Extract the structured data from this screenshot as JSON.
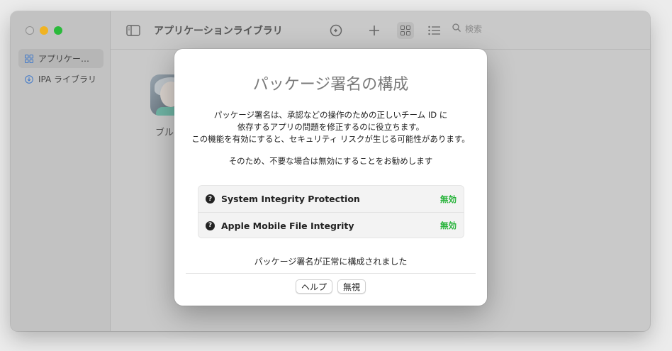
{
  "sidebar": {
    "items": [
      {
        "label": "アプリケー…",
        "icon": "grid-icon",
        "active": true
      },
      {
        "label": "IPA ライブラリ",
        "icon": "download-circle-icon",
        "active": false
      }
    ]
  },
  "toolbar": {
    "title": "アプリケーションライブラリ",
    "search_placeholder": "検索",
    "icons": [
      "sidebar-toggle-icon",
      "sync-icon",
      "plus-icon",
      "grid-view-icon",
      "list-view-icon",
      "search-icon"
    ]
  },
  "content": {
    "app_label": "ブルア"
  },
  "dialog": {
    "title": "パッケージ署名の構成",
    "description": [
      "パッケージ署名は、承認などの操作のための正しいチーム ID に",
      "依存するアプリの問題を修正するのに役立ちます。",
      "この機能を有効にすると、セキュリティ リスクが生じる可能性があります。"
    ],
    "recommendation": "そのため、不要な場合は無効にすることをお勧めします",
    "rows": [
      {
        "label": "System Integrity Protection",
        "status": "無効"
      },
      {
        "label": "Apple Mobile File Integrity",
        "status": "無効"
      }
    ],
    "status_message": "パッケージ署名が正常に構成されました",
    "help_button": "ヘルプ",
    "ignore_button": "無視",
    "status_color": "#27b33a"
  }
}
